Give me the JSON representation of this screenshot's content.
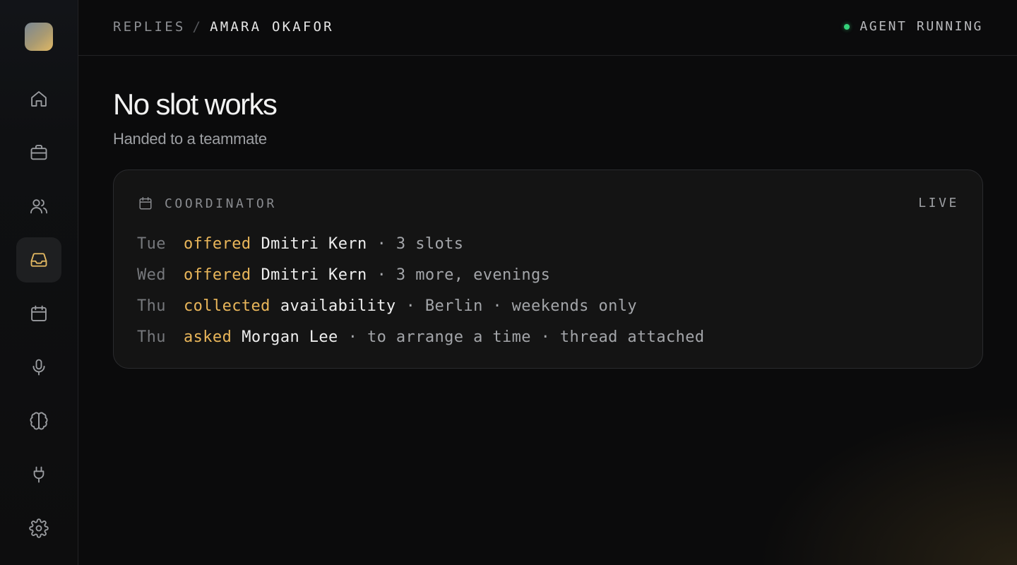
{
  "breadcrumb": {
    "parent": "REPLIES",
    "separator": "/",
    "current": "AMARA OKAFOR"
  },
  "status": {
    "label": "AGENT RUNNING",
    "color": "#34d27a"
  },
  "sidebar": {
    "items": [
      {
        "icon": "home-icon"
      },
      {
        "icon": "briefcase-icon"
      },
      {
        "icon": "users-icon"
      },
      {
        "icon": "inbox-icon",
        "active": true
      },
      {
        "icon": "calendar-icon"
      },
      {
        "icon": "microphone-icon"
      },
      {
        "icon": "brain-icon"
      },
      {
        "icon": "plug-icon"
      },
      {
        "icon": "gear-icon"
      }
    ]
  },
  "page": {
    "title": "No slot works",
    "subtitle": "Handed to a teammate"
  },
  "card": {
    "label": "COORDINATOR",
    "live": "LIVE",
    "events": [
      {
        "day": "Tue",
        "verb": "offered",
        "subject": "Dmitri Kern",
        "rest": "· 3 slots"
      },
      {
        "day": "Wed",
        "verb": "offered",
        "subject": "Dmitri Kern",
        "rest": "· 3 more, evenings"
      },
      {
        "day": "Thu",
        "verb": "collected",
        "subject": "availability",
        "rest": "· Berlin · weekends only"
      },
      {
        "day": "Thu",
        "verb": "asked",
        "subject": "Morgan Lee",
        "rest": "· to arrange a time · thread attached"
      }
    ]
  },
  "colors": {
    "accent": "#e9b65a",
    "background": "#0b0b0c",
    "status": "#34d27a"
  }
}
